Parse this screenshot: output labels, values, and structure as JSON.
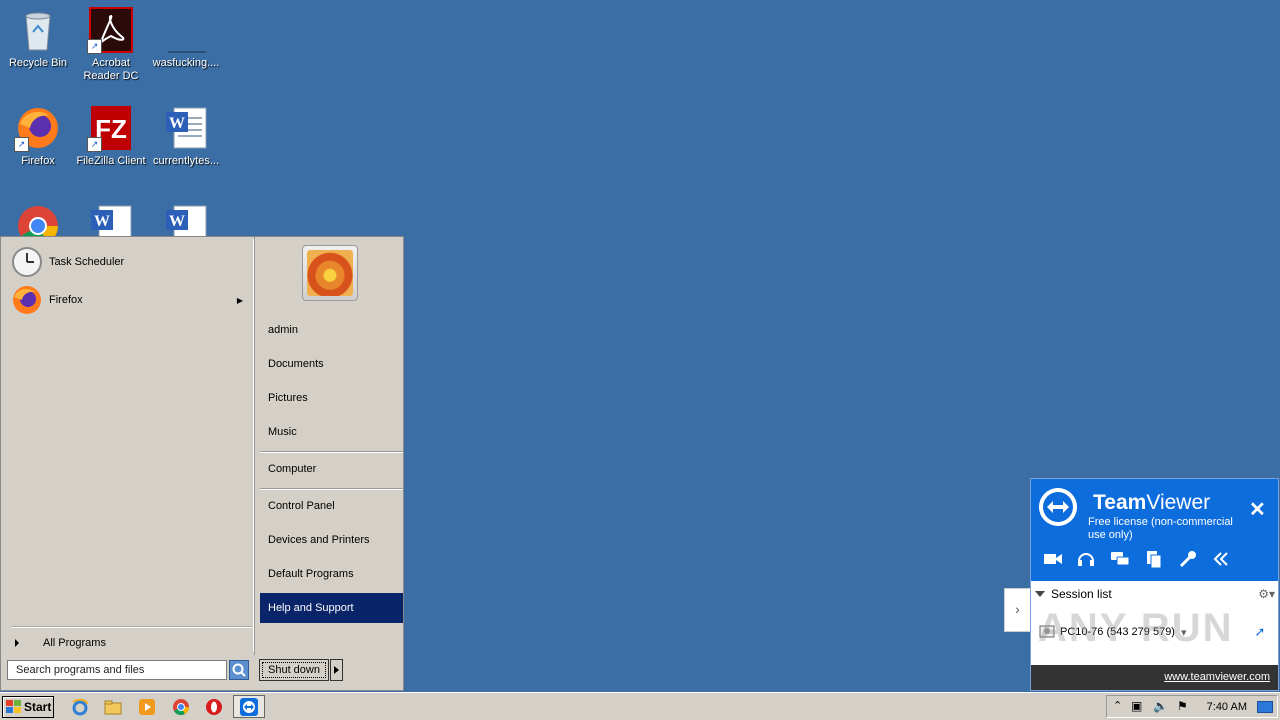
{
  "desktop": {
    "icons": [
      {
        "label": "Recycle Bin"
      },
      {
        "label": "Acrobat Reader DC"
      },
      {
        "label": "wasfucking...."
      },
      {
        "label": "Firefox"
      },
      {
        "label": "FileZilla Client"
      },
      {
        "label": "currentlytes..."
      }
    ]
  },
  "startmenu": {
    "pinned": [
      {
        "label": "Task Scheduler"
      },
      {
        "label": "Firefox"
      }
    ],
    "all_programs": "All Programs",
    "search_placeholder": "Search programs and files",
    "right_items": [
      {
        "label": "admin"
      },
      {
        "label": "Documents"
      },
      {
        "label": "Pictures"
      },
      {
        "label": "Music"
      },
      {
        "label": "Computer"
      },
      {
        "label": "Control Panel"
      },
      {
        "label": "Devices and Printers"
      },
      {
        "label": "Default Programs"
      },
      {
        "label": "Help and Support"
      }
    ],
    "shutdown": "Shut down"
  },
  "taskbar": {
    "start": "Start",
    "clock": "7:40 AM"
  },
  "teamviewer": {
    "title_bold": "Team",
    "title_rest": "Viewer",
    "subtitle": "Free license (non-commercial use only)",
    "session_list": "Session list",
    "session_entry": "PC10-76 (543 279 579)",
    "link": "www.teamviewer.com"
  },
  "watermark": "ANY RUN"
}
